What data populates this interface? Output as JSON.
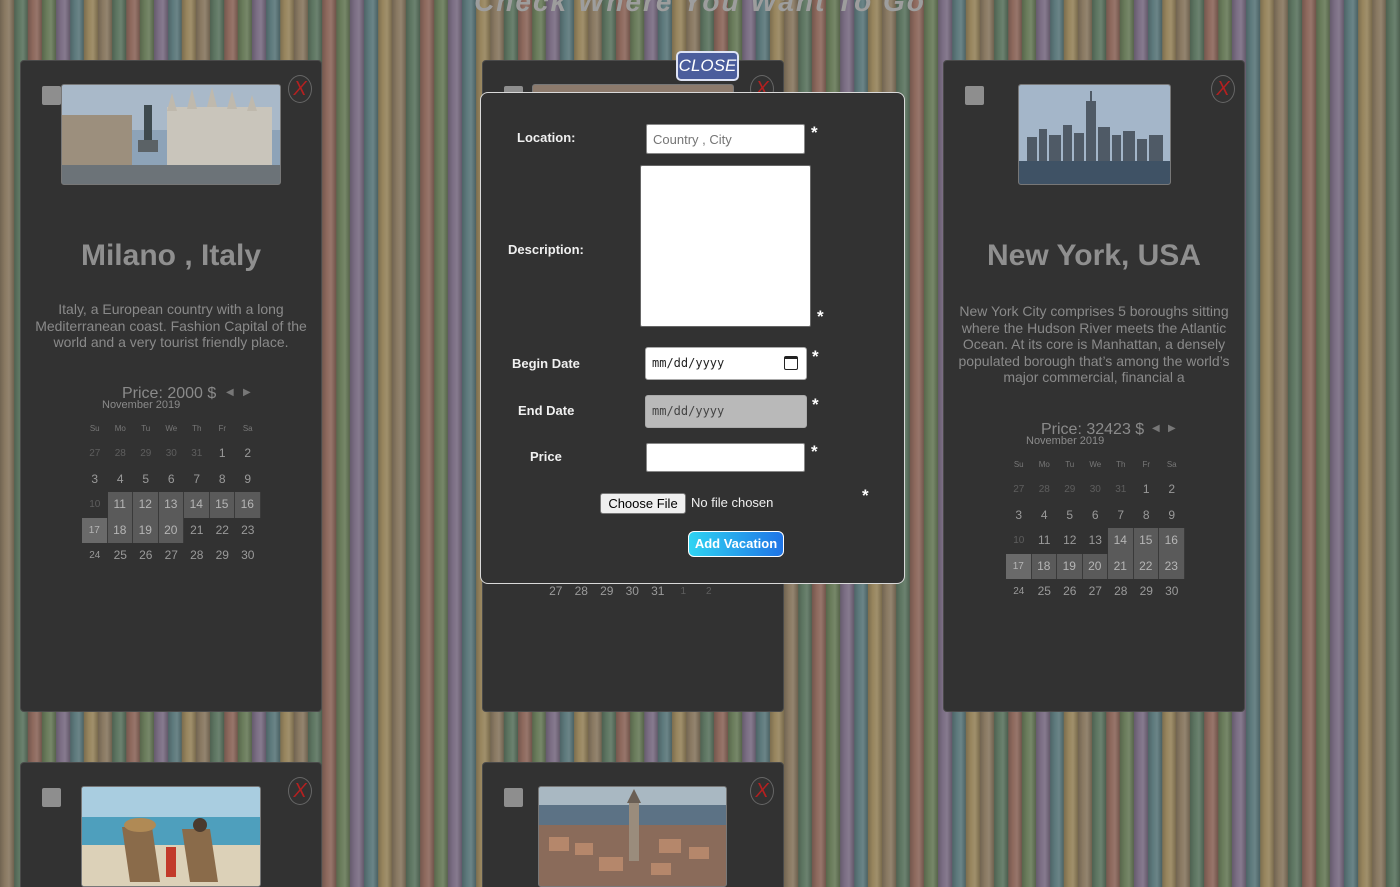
{
  "page": {
    "title": "Check Where You Want To Go"
  },
  "cards": [
    {
      "city": "Milano , Italy",
      "description": "Italy, a European country with a long Mediterranean coast. Fashion Capital of the world and a very tourist friendly place.",
      "price": "Price: 2000 $",
      "calendar": {
        "month": "November 2019",
        "days_header": [
          "Su",
          "Mo",
          "Tu",
          "We",
          "Th",
          "Fr",
          "Sa"
        ],
        "days": [
          "27",
          "28",
          "29",
          "30",
          "31",
          "1",
          "2",
          "3",
          "4",
          "5",
          "6",
          "7",
          "8",
          "9",
          "10",
          "11",
          "12",
          "13",
          "14",
          "15",
          "16",
          "17",
          "18",
          "19",
          "20",
          "21",
          "22",
          "23",
          "24",
          "25",
          "26",
          "27",
          "28",
          "29",
          "30"
        ]
      }
    },
    {
      "city": "New York, USA",
      "description": "New York City comprises 5 boroughs sitting where the Hudson River meets the Atlantic Ocean. At its core is Manhattan, a densely populated borough that’s among the world’s major commercial, financial a",
      "price": "Price: 32423 $",
      "calendar": {
        "month": "November 2019",
        "days_header": [
          "Su",
          "Mo",
          "Tu",
          "We",
          "Th",
          "Fr",
          "Sa"
        ],
        "days": [
          "27",
          "28",
          "29",
          "30",
          "31",
          "1",
          "2",
          "3",
          "4",
          "5",
          "6",
          "7",
          "8",
          "9",
          "10",
          "11",
          "12",
          "13",
          "14",
          "15",
          "16",
          "17",
          "18",
          "19",
          "20",
          "21",
          "22",
          "23",
          "24",
          "25",
          "26",
          "27",
          "28",
          "29",
          "30"
        ]
      }
    }
  ],
  "middle_card_partial_days": [
    "27",
    "28",
    "29",
    "30",
    "31",
    "1",
    "2"
  ],
  "remove_label": "X",
  "cal_nav": {
    "prev": "◀",
    "next": "▶"
  },
  "modal": {
    "close_label": "CLOSE",
    "location_label": "Location:",
    "location_placeholder": "Country , City",
    "description_label": "Description:",
    "begin_date_label": "Begin Date",
    "begin_date_value": "mm/dd/yyyy",
    "end_date_label": "End Date",
    "end_date_value": "mm/dd/yyyy",
    "price_label": "Price",
    "required_mark": "*",
    "choose_file_label": "Choose File",
    "file_status": "No file chosen",
    "submit_label": "Add Vacation"
  },
  "colors": {
    "card_bg": "#323232",
    "close_button": "#4b5d9c",
    "remove_x": "#b32020",
    "submit_gradient_start": "#2fd4f2",
    "submit_gradient_end": "#1f74e6"
  }
}
